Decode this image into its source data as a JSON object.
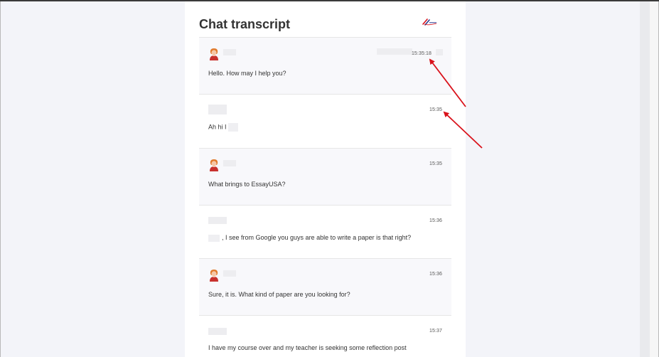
{
  "page": {
    "title": "Chat transcript"
  },
  "colors": {
    "annotation_arrow": "#d9121b",
    "agent_row_bg": "#f8f8fb",
    "visitor_row_bg": "#ffffff"
  },
  "icons": {
    "logo": "brand-logo-icon",
    "agent_avatar": "agent-avatar-icon"
  },
  "messages": [
    {
      "sender": "agent",
      "time": "15:35:18",
      "text": "Hello. How may I help you?"
    },
    {
      "sender": "visitor",
      "time": "15:35",
      "text": "Ah hi I"
    },
    {
      "sender": "agent",
      "time": "15:35",
      "text": "What brings to EssayUSA?"
    },
    {
      "sender": "visitor",
      "time": "15:36",
      "text": ", I see from Google you guys are able to write a paper is that right?"
    },
    {
      "sender": "agent",
      "time": "15:36",
      "text": "Sure, it is. What kind of paper are you looking for?"
    },
    {
      "sender": "visitor",
      "time": "15:37",
      "text": "I have my course over and my teacher is seeking some reflection post"
    }
  ]
}
